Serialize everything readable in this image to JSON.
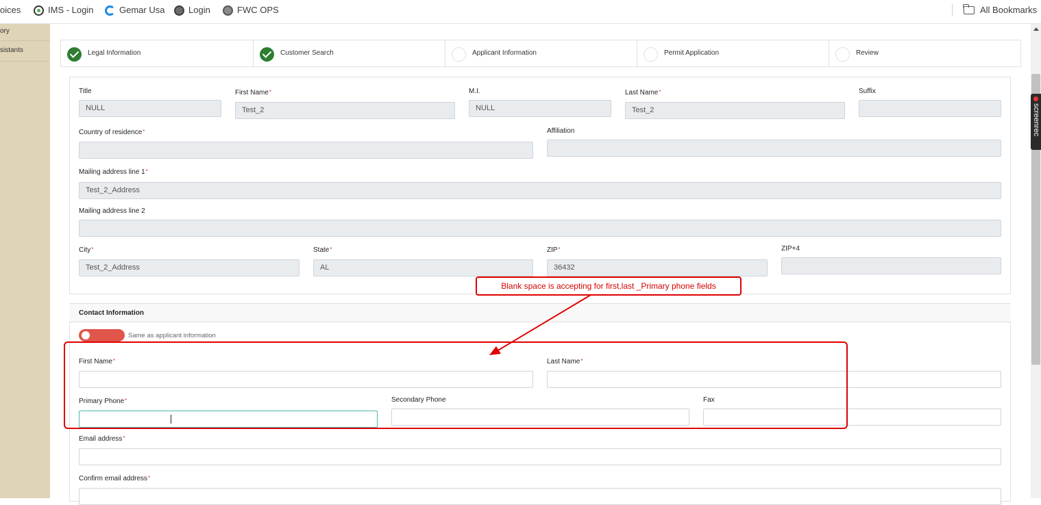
{
  "bookmarks": {
    "items": [
      {
        "label": "oices",
        "icon": "none"
      },
      {
        "label": "IMS - Login",
        "icon": "ims-logo-icon"
      },
      {
        "label": "Gemar Usa",
        "icon": "gemar-logo-icon"
      },
      {
        "label": "Login",
        "icon": "shield-seal-icon"
      },
      {
        "label": "FWC OPS",
        "icon": "fwc-seal-icon"
      }
    ],
    "all_bookmarks": "All Bookmarks"
  },
  "sidebar": {
    "items": [
      {
        "label": "ory"
      },
      {
        "label": "sistants"
      }
    ]
  },
  "screenrec": {
    "label": "screenrec"
  },
  "stepper": {
    "steps": [
      {
        "label": "Legal Information",
        "status": "done"
      },
      {
        "label": "Customer Search",
        "status": "done"
      },
      {
        "label": "Applicant Information",
        "status": "todo"
      },
      {
        "label": "Permit Application",
        "status": "todo"
      },
      {
        "label": "Review",
        "status": "todo"
      }
    ]
  },
  "applicant": {
    "title": {
      "label": "Title",
      "value": "NULL"
    },
    "first_name": {
      "label": "First Name",
      "value": "Test_2"
    },
    "mi": {
      "label": "M.I.",
      "value": "NULL"
    },
    "last_name": {
      "label": "Last Name",
      "value": "Test_2"
    },
    "suffix": {
      "label": "Suffix",
      "value": ""
    },
    "country": {
      "label": "Country of residence",
      "value": ""
    },
    "affiliation": {
      "label": "Affiliation",
      "value": ""
    },
    "address1": {
      "label": "Mailing address line 1",
      "value": "Test_2_Address"
    },
    "address2": {
      "label": "Mailing address line 2",
      "value": ""
    },
    "city": {
      "label": "City",
      "value": "Test_2_Address"
    },
    "state": {
      "label": "State",
      "value": "AL"
    },
    "zip": {
      "label": "ZIP",
      "value": "36432"
    },
    "zip4": {
      "label": "ZIP+4",
      "value": ""
    }
  },
  "contact": {
    "heading": "Contact Information",
    "same_as": "Same as applicant information",
    "first_name": {
      "label": "First Name",
      "value": ""
    },
    "last_name": {
      "label": "Last Name",
      "value": ""
    },
    "primary_phone": {
      "label": "Primary Phone",
      "value": ""
    },
    "secondary_phone": {
      "label": "Secondary Phone",
      "value": ""
    },
    "fax": {
      "label": "Fax",
      "value": ""
    },
    "email": {
      "label": "Email address",
      "value": ""
    },
    "confirm_email": {
      "label": "Confirm email address",
      "value": ""
    }
  },
  "annotation": {
    "text": "Blank space is accepting for first,last _Primary phone fields",
    "color": "#e00000"
  }
}
